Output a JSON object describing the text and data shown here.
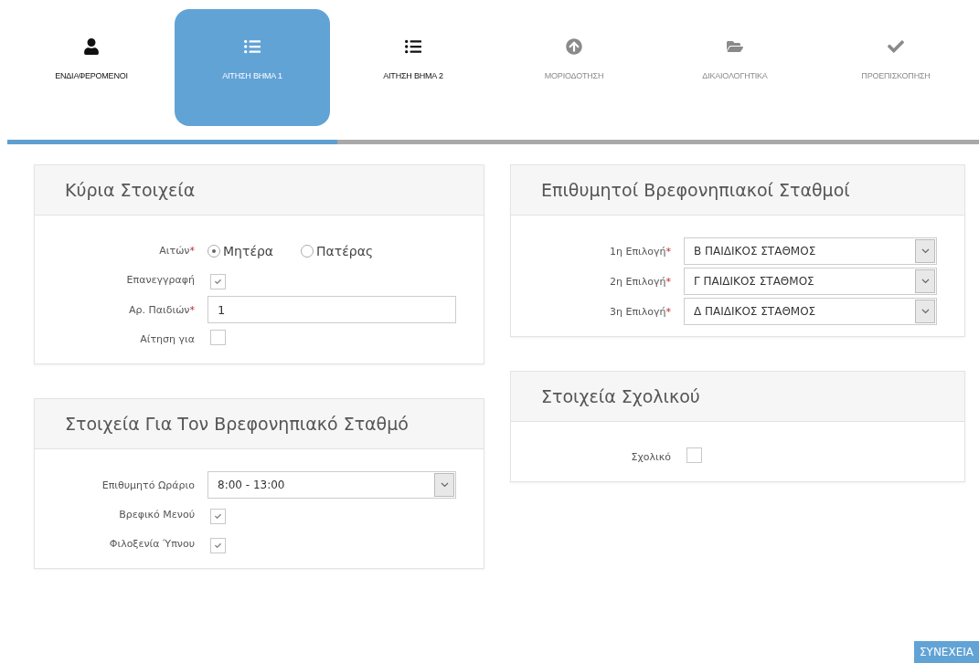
{
  "steps": [
    {
      "label": "ΕΝΔΙΑΦΕΡΟΜΕΝΟΙ",
      "selected": false,
      "disabled": false
    },
    {
      "label": "ΑΙΤΗΣΗ ΒΗΜΑ 1",
      "selected": true,
      "disabled": false
    },
    {
      "label": "ΑΙΤΗΣΗ ΒΗΜΑ 2",
      "selected": false,
      "disabled": false
    },
    {
      "label": "ΜΟΡΙΟΔΟΤΗΣΗ",
      "selected": false,
      "disabled": true
    },
    {
      "label": "ΔΙΚΑΙΟΛΟΓΗΤΙΚΑ",
      "selected": false,
      "disabled": true
    },
    {
      "label": "ΠΡΟΕΠΙΣΚΟΠΗΣΗ",
      "selected": false,
      "disabled": true
    }
  ],
  "progress": {
    "level": 0.34
  },
  "left_panels": [
    {
      "title": "Κύρια Στοιχεία",
      "fields": [
        {
          "kind": "radio",
          "label": "Αιτών",
          "mark": "*",
          "options": [
            {
              "label": "Μητέρα",
              "selected": true
            },
            {
              "label": "Πατέρας",
              "selected": false
            }
          ]
        },
        {
          "kind": "checkbox",
          "label": "Επανεγγραφή",
          "checked": true
        },
        {
          "kind": "text",
          "label": "Αρ. Παιδιών",
          "mark": "*",
          "value": "1"
        },
        {
          "kind": "checkbox",
          "label": "Αίτηση για",
          "checked": false
        }
      ]
    },
    {
      "title": "Στοιχεία Για Τον Βρεφονηπιακό Σταθμό",
      "fields": [
        {
          "kind": "select",
          "label": "Επιθυμητό Ωράριο",
          "value": "8:00 - 13:00"
        },
        {
          "kind": "checkbox",
          "label": "Βρεφικό Μενού",
          "checked": true
        },
        {
          "kind": "checkbox",
          "label": "Φιλοξενία Ύπνου",
          "checked": true
        }
      ]
    }
  ],
  "right_panels": [
    {
      "title": "Επιθυμητοί Βρεφονηπιακοί Σταθμοί",
      "fields": [
        {
          "kind": "select",
          "label": "1η Επιλογή",
          "mark": "*",
          "value": "Β ΠΑΙΔΙΚΟΣ ΣΤΑΘΜΟΣ"
        },
        {
          "kind": "select",
          "label": "2η Επιλογή",
          "mark": "*",
          "value": "Γ ΠΑΙΔΙΚΟΣ ΣΤΑΘΜΟΣ"
        },
        {
          "kind": "select",
          "label": "3η Επιλογή",
          "mark": "*",
          "value": "Δ ΠΑΙΔΙΚΟΣ ΣΤΑΘΜΟΣ"
        }
      ]
    },
    {
      "title": "Στοιχεία Σχολικού",
      "fields": [
        {
          "kind": "checkbox",
          "label": "Σχολικό",
          "checked": false
        }
      ]
    }
  ],
  "continue_button": {
    "label": "ΣΥΝΕΧΕΙΑ"
  }
}
